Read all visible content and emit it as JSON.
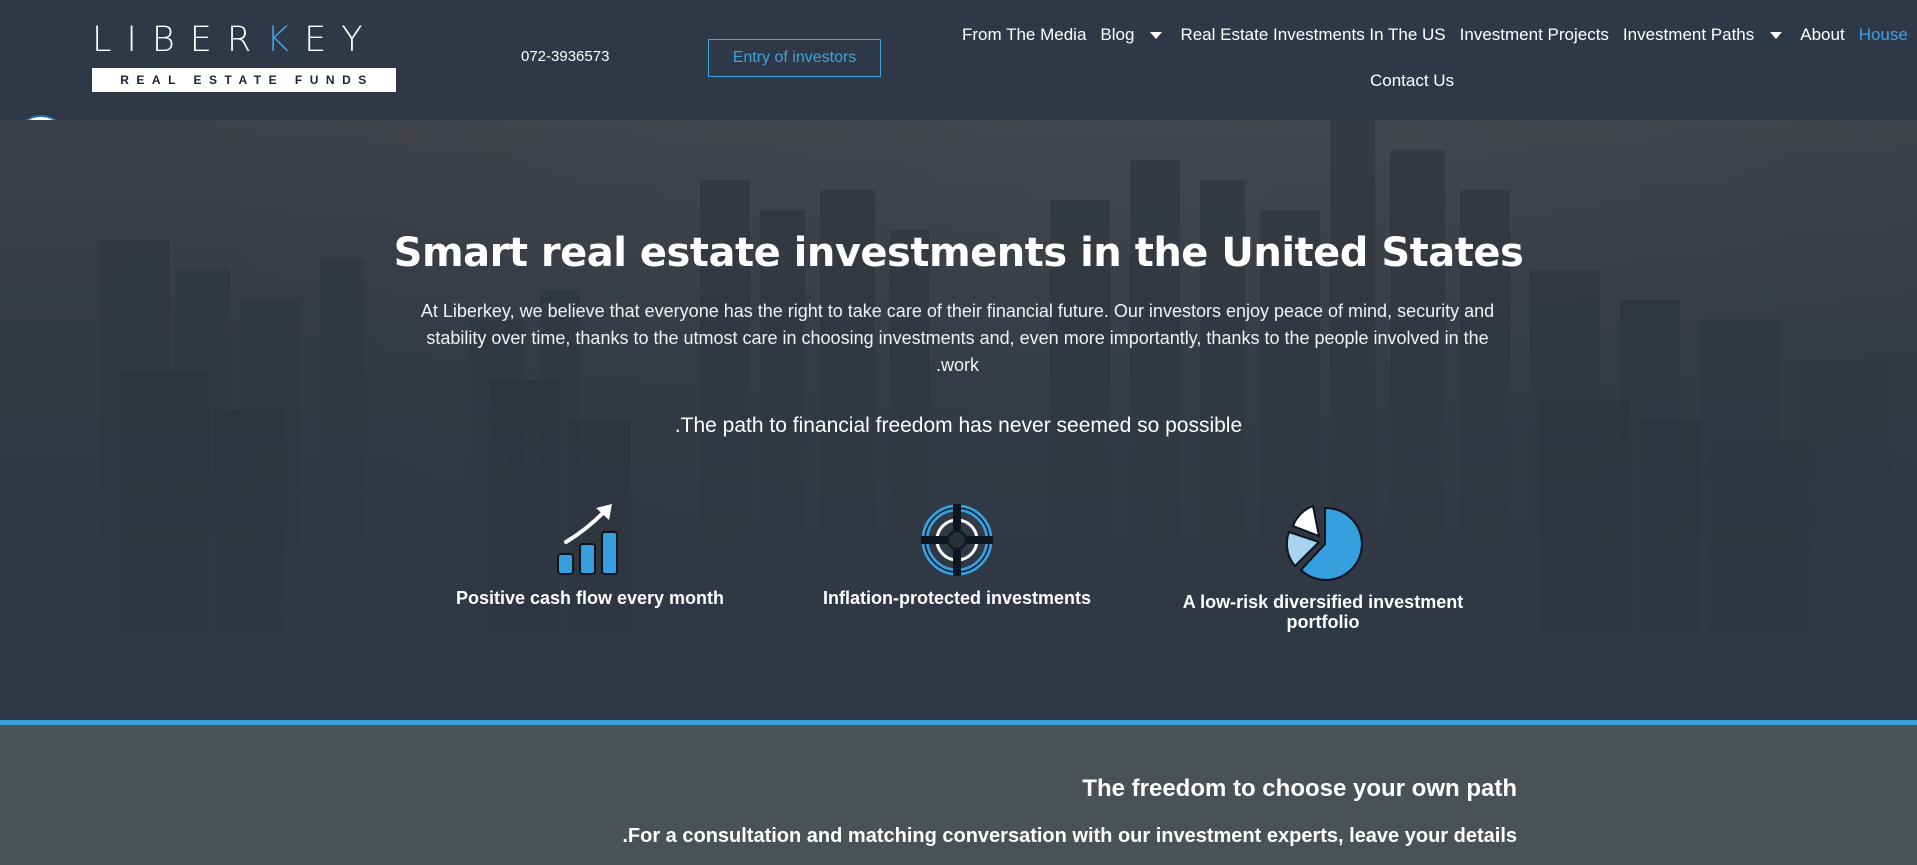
{
  "header": {
    "logo_main_before": "LIBER",
    "logo_main_accent": "K",
    "logo_main_after": "EY",
    "logo_sub": "REAL ESTATE FUNDS",
    "phone": "072-3936573",
    "investors_button": "Entry of investors",
    "nav": {
      "from_media": "From The Media",
      "blog": "Blog",
      "us_investments": "Real Estate Investments In The US",
      "projects": "Investment Projects",
      "paths": "Investment Paths",
      "about": "About",
      "house": "House",
      "contact": "Contact Us"
    }
  },
  "hero": {
    "title": "Smart real estate investments in the United States",
    "description_line1": "At Liberkey, we believe that everyone has the right to take care of their financial future. Our investors enjoy peace of mind, security and",
    "description_line2": "stability over time, thanks to the utmost care in choosing investments and, even more importantly, thanks to the people involved in the",
    "description_line3": ".work",
    "subtitle": ".The path to financial freedom has never seemed so possible",
    "features": [
      {
        "label": "Positive cash flow every month",
        "icon": "chart-growth-icon"
      },
      {
        "label": "Inflation-protected investments",
        "icon": "target-icon"
      },
      {
        "label_line1": "A low-risk diversified investment",
        "label_line2": "portfolio",
        "icon": "pie-chart-icon"
      }
    ]
  },
  "lower": {
    "title": "The freedom to choose your own path",
    "text": ".For a consultation and matching conversation with our investment experts, leave your details"
  },
  "colors": {
    "accent": "#3fa3e0",
    "header_bg": "#2e3846",
    "lower_bg": "#4b5256"
  }
}
